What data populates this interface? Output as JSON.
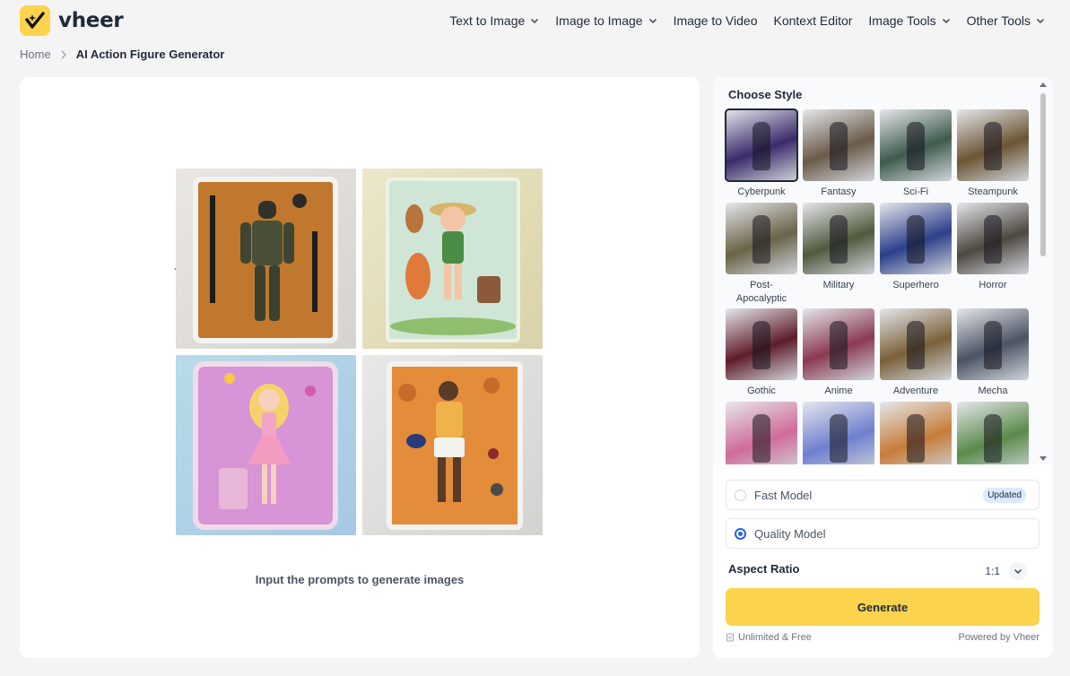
{
  "brand": {
    "name": "vheer",
    "accent": "#fcd34d"
  },
  "nav": [
    {
      "label": "Text to Image",
      "dropdown": true
    },
    {
      "label": "Image to Image",
      "dropdown": true
    },
    {
      "label": "Image to Video",
      "dropdown": false
    },
    {
      "label": "Kontext Editor",
      "dropdown": false
    },
    {
      "label": "Image Tools",
      "dropdown": true
    },
    {
      "label": "Other Tools",
      "dropdown": true
    }
  ],
  "breadcrumb": {
    "home": "Home",
    "current": "AI Action Figure Generator"
  },
  "preview": {
    "hint": "Input the prompts to generate images",
    "images": [
      "soldier-action-figure",
      "explorer-girl-figure",
      "princess-figure",
      "basketball-player-figure"
    ]
  },
  "style_panel": {
    "title": "Choose Style",
    "selected": "Cyberpunk",
    "styles": [
      {
        "label": "Cyberpunk",
        "color": "#3b2a6b"
      },
      {
        "label": "Fantasy",
        "color": "#6b5a48"
      },
      {
        "label": "Sci-Fi",
        "color": "#3f5b4d"
      },
      {
        "label": "Steampunk",
        "color": "#6b5533"
      },
      {
        "label": "Post-Apocalyptic",
        "color": "#6a6347"
      },
      {
        "label": "Military",
        "color": "#4f5a3d"
      },
      {
        "label": "Superhero",
        "color": "#2c3f8a"
      },
      {
        "label": "Horror",
        "color": "#4e4741"
      },
      {
        "label": "Gothic",
        "color": "#5e1c2a"
      },
      {
        "label": "Anime",
        "color": "#8a3a52"
      },
      {
        "label": "Adventure",
        "color": "#7a6039"
      },
      {
        "label": "Mecha",
        "color": "#4b5364"
      },
      {
        "label": "",
        "color": "#d06b9a"
      },
      {
        "label": "",
        "color": "#6f7fcf"
      },
      {
        "label": "",
        "color": "#c77c39"
      },
      {
        "label": "",
        "color": "#5a8a4a"
      }
    ]
  },
  "models": {
    "fast_label": "Fast Model",
    "fast_badge": "Updated",
    "quality_label": "Quality Model",
    "selected": "Quality Model"
  },
  "aspect": {
    "label": "Aspect Ratio",
    "value": "1:1"
  },
  "generate_label": "Generate",
  "footer": {
    "left": "Unlimited & Free",
    "right": "Powered by Vheer"
  }
}
